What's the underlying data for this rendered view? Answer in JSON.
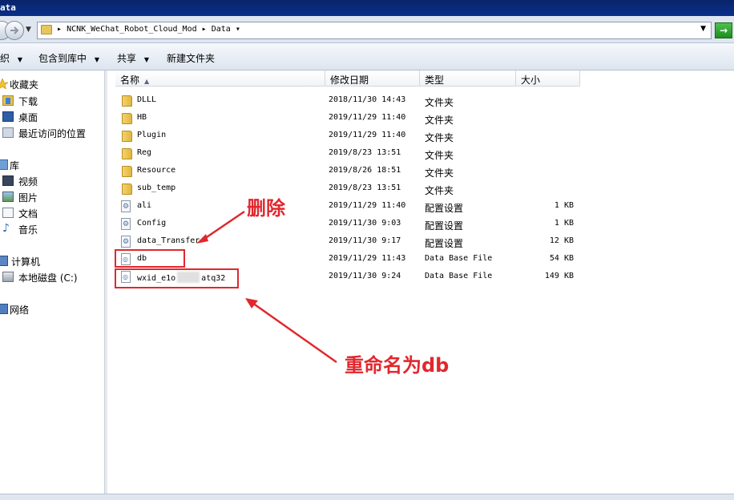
{
  "window": {
    "title": "ata"
  },
  "address": {
    "path_root": "NCNK_WeChat_Robot_Cloud_Mod",
    "path_sep": "▸",
    "path_leaf": "Data",
    "leaf_arrow": "▾"
  },
  "toolbar": {
    "organize": "织",
    "include_library": "包含到库中",
    "share": "共享",
    "new_folder": "新建文件夹",
    "arrow": "▼"
  },
  "sidebar": {
    "items": [
      {
        "label": "收藏夹",
        "icon": "star-icon"
      },
      {
        "label": "下载",
        "icon": "download-icon"
      },
      {
        "label": "桌面",
        "icon": "desktop-icon"
      },
      {
        "label": "最近访问的位置",
        "icon": "recent-icon"
      },
      {
        "label": "库",
        "icon": "library-icon"
      },
      {
        "label": "视频",
        "icon": "video-icon"
      },
      {
        "label": "图片",
        "icon": "picture-icon"
      },
      {
        "label": "文档",
        "icon": "document-icon"
      },
      {
        "label": "音乐",
        "icon": "music-icon"
      },
      {
        "label": "计算机",
        "icon": "computer-icon"
      },
      {
        "label": "本地磁盘 (C:)",
        "icon": "disk-icon"
      },
      {
        "label": "网络",
        "icon": "network-icon"
      }
    ]
  },
  "columns": {
    "name": "名称",
    "modified": "修改日期",
    "type": "类型",
    "size": "大小"
  },
  "files": [
    {
      "name": "DLLL",
      "modified": "2018/11/30 14:43",
      "type": "文件夹",
      "size": "",
      "kind": "folder"
    },
    {
      "name": "HB",
      "modified": "2019/11/29 11:40",
      "type": "文件夹",
      "size": "",
      "kind": "folder"
    },
    {
      "name": "Plugin",
      "modified": "2019/11/29 11:40",
      "type": "文件夹",
      "size": "",
      "kind": "folder"
    },
    {
      "name": "Reg",
      "modified": "2019/8/23 13:51",
      "type": "文件夹",
      "size": "",
      "kind": "folder"
    },
    {
      "name": "Resource",
      "modified": "2019/8/26 18:51",
      "type": "文件夹",
      "size": "",
      "kind": "folder"
    },
    {
      "name": "sub_temp",
      "modified": "2019/8/23 13:51",
      "type": "文件夹",
      "size": "",
      "kind": "folder"
    },
    {
      "name": "ali",
      "modified": "2019/11/29 11:40",
      "type": "配置设置",
      "size": "1 KB",
      "kind": "config"
    },
    {
      "name": "Config",
      "modified": "2019/11/30 9:03",
      "type": "配置设置",
      "size": "1 KB",
      "kind": "config"
    },
    {
      "name": "data_Transfer",
      "modified": "2019/11/30 9:17",
      "type": "配置设置",
      "size": "12 KB",
      "kind": "config"
    },
    {
      "name": "db",
      "modified": "2019/11/29 11:43",
      "type": "Data Base File",
      "size": "54 KB",
      "kind": "db"
    },
    {
      "name_start": "wxid_e1o",
      "name_end": "atq32",
      "modified": "2019/11/30 9:24",
      "type": "Data Base File",
      "size": "149 KB",
      "kind": "db"
    }
  ],
  "annotations": {
    "delete": "删除",
    "rename": "重命名为db",
    "color": "#e0282e"
  }
}
